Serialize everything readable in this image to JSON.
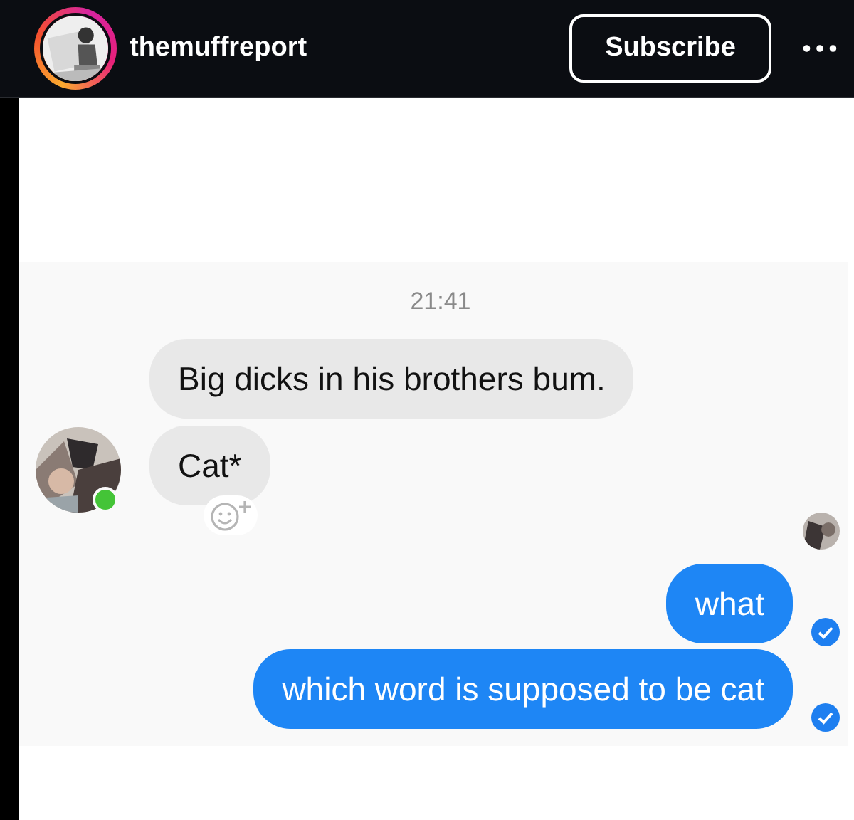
{
  "header": {
    "username": "themuffreport",
    "story_ring": true,
    "subscribe_button": "Subscribe"
  },
  "chat": {
    "timestamp": "21:41",
    "incoming_avatar": {
      "online": true
    },
    "messages": [
      {
        "kind": "incoming",
        "text": "Big dicks in his brothers bum.",
        "reaction_button": false
      },
      {
        "kind": "incoming",
        "text": "Cat*",
        "reaction_button": true
      },
      {
        "kind": "seen"
      },
      {
        "kind": "outgoing",
        "text": "what",
        "delivered": true
      },
      {
        "kind": "outgoing",
        "text": "which word is supposed to be cat",
        "delivered": true
      }
    ]
  }
}
